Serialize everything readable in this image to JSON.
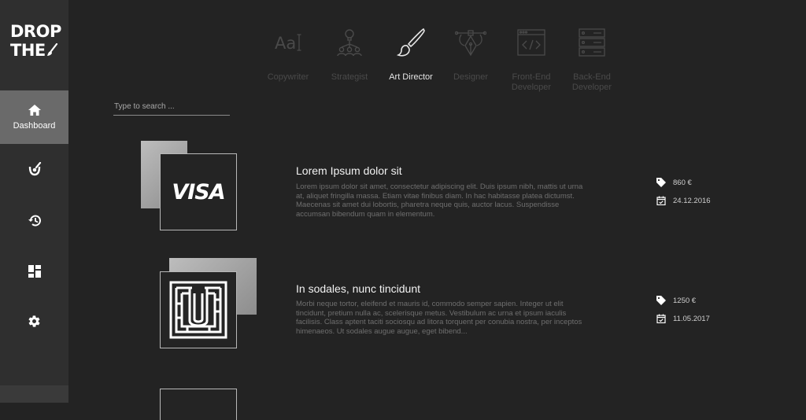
{
  "logo": {
    "line1": "DROP",
    "line2": "THE"
  },
  "sidebar": {
    "items": [
      {
        "label": "Dashboard",
        "icon": "home-icon",
        "active": true
      },
      {
        "label": "",
        "icon": "brush-bucket-icon"
      },
      {
        "label": "",
        "icon": "history-icon"
      },
      {
        "label": "",
        "icon": "dashboard-grid-icon"
      },
      {
        "label": "",
        "icon": "gear-icon"
      }
    ]
  },
  "categories": [
    {
      "label": "Copywriter",
      "icon": "typography-icon"
    },
    {
      "label": "Strategist",
      "icon": "strategy-idea-icon"
    },
    {
      "label": "Art Director",
      "icon": "paintbrush-icon",
      "active": true
    },
    {
      "label": "Designer",
      "icon": "pen-tool-icon"
    },
    {
      "label": "Front-End Developer",
      "icon": "code-window-icon"
    },
    {
      "label": "Back-End Developer",
      "icon": "server-icon"
    }
  ],
  "search": {
    "placeholder": "Type to search ..."
  },
  "items": [
    {
      "title": "Lorem Ipsum dolor sit",
      "description": "Lorem ipsum dolor sit amet, consectetur adipiscing elit. Duis ipsum nibh, mattis ut urna at, aliquet fringilla massa. Etiam vitae finibus diam. In hac habitasse platea dictumst. Maecenas sit amet dui lobortis, pharetra neque quis, auctor lacus. Suspendisse accumsan bibendum quam in elementum.",
      "price": "860 €",
      "date": "24.12.2016",
      "logo_text": "VISA"
    },
    {
      "title": "In sodales, nunc tincidunt",
      "description": "Morbi neque tortor, eleifend et mauris id, commodo semper sapien. Integer ut elit tincidunt, pretium nulla ac, scelerisque metus. Vestibulum ac urna et ipsum iaculis facilisis. Class aptent taciti sociosqu ad litora torquent per conubia nostra, per inceptos himenaeos. Ut sodales augue augue, eget bibend...",
      "price": "1250 €",
      "date": "11.05.2017",
      "logo_text": ""
    }
  ],
  "colors": {
    "background": "#232323",
    "sidebar": "#2f2f2f",
    "active_nav": "#6a6a6a",
    "accent_text": "#f2f2f2"
  }
}
